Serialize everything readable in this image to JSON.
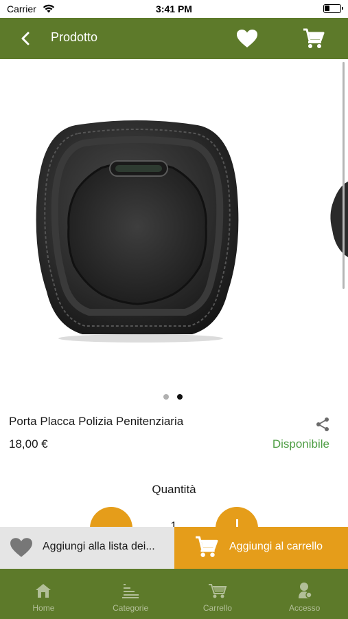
{
  "status_bar": {
    "carrier": "Carrier",
    "time": "3:41 PM",
    "battery_level": 0.35
  },
  "header": {
    "title": "Prodotto",
    "back_icon": "chevron-left-icon",
    "favorite_icon": "heart-icon",
    "cart_icon": "cart-icon"
  },
  "carousel": {
    "image_name": "porta-placca-leather-badge-holder",
    "page_count": 2,
    "current_page": 2
  },
  "product": {
    "name": "Porta Placca Polizia Penitenziaria",
    "price": "18,00 €",
    "availability": "Disponibile",
    "share_icon": "share-icon"
  },
  "quantity": {
    "label": "Quantità",
    "value": "1"
  },
  "actions": {
    "wishlist_label": "Aggiungi alla lista dei...",
    "add_to_cart_label": "Aggiungi al carrello"
  },
  "tabs": [
    {
      "label": "Home",
      "icon": "home-icon"
    },
    {
      "label": "Categorie",
      "icon": "categories-icon"
    },
    {
      "label": "Carrello",
      "icon": "cart-icon"
    },
    {
      "label": "Accesso",
      "icon": "user-icon"
    }
  ],
  "colors": {
    "primary": "#5d7a2a",
    "accent": "#e59d1a",
    "available": "#4f9e45"
  }
}
